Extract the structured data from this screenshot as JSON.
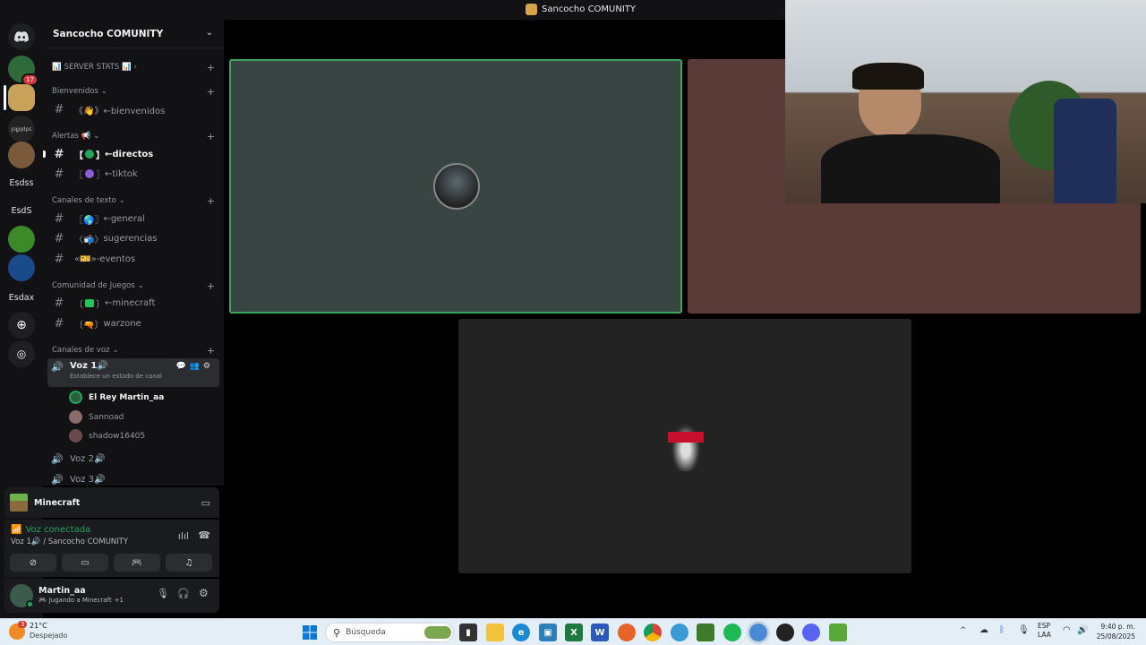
{
  "window": {
    "title": "Sancocho COMUNITY"
  },
  "rail": {
    "badge_count": "17",
    "text_servers": [
      "Esdss",
      "EsdS",
      "Esdax"
    ]
  },
  "server": {
    "name": "Sancocho COMUNITY",
    "stats_label": "SERVER STATS",
    "categories": {
      "bienvenidos": "Bienvenidos",
      "alertas": "Alertas",
      "texto": "Canales de texto",
      "juegos": "Comunidad de Juegos",
      "voz": "Canales de voz"
    },
    "channels": {
      "bienvenidos": "《👋》←bienvenidos",
      "directos": "←directos",
      "tiktok": "←tiktok",
      "general": "←general",
      "sugerencias": "sugerencias",
      "eventos": "»-eventos",
      "minecraft": "←minecraft",
      "warzone": "warzone"
    },
    "voice": {
      "voz1": "Voz 1🔊",
      "voz1_status": "Establece un estado de canal",
      "voz2": "Voz 2🔊",
      "voz3": "Voz 3🔊",
      "users": [
        "El Rey Martin_aa",
        "Sannoad",
        "shadow16405"
      ]
    }
  },
  "activity": {
    "game": "Minecraft"
  },
  "voice_panel": {
    "status": "Voz conectada",
    "channel": "Voz 1🔊 / Sancocho COMUNITY"
  },
  "user": {
    "name": "Martin_aa",
    "status": "Jugando a Minecraft",
    "extra": "+1"
  },
  "taskbar": {
    "temp": "21°C",
    "weather": "Despejado",
    "weather_badge": "3",
    "search_placeholder": "Búsqueda",
    "lang1": "ESP",
    "lang2": "LAA",
    "time": "9:40 p. m.",
    "date": "25/08/2025"
  },
  "colors": {
    "accent_green": "#23a55a",
    "tile1_bg": "#394543",
    "tile2_bg": "#5a3b37",
    "tile3_bg": "#232323"
  }
}
